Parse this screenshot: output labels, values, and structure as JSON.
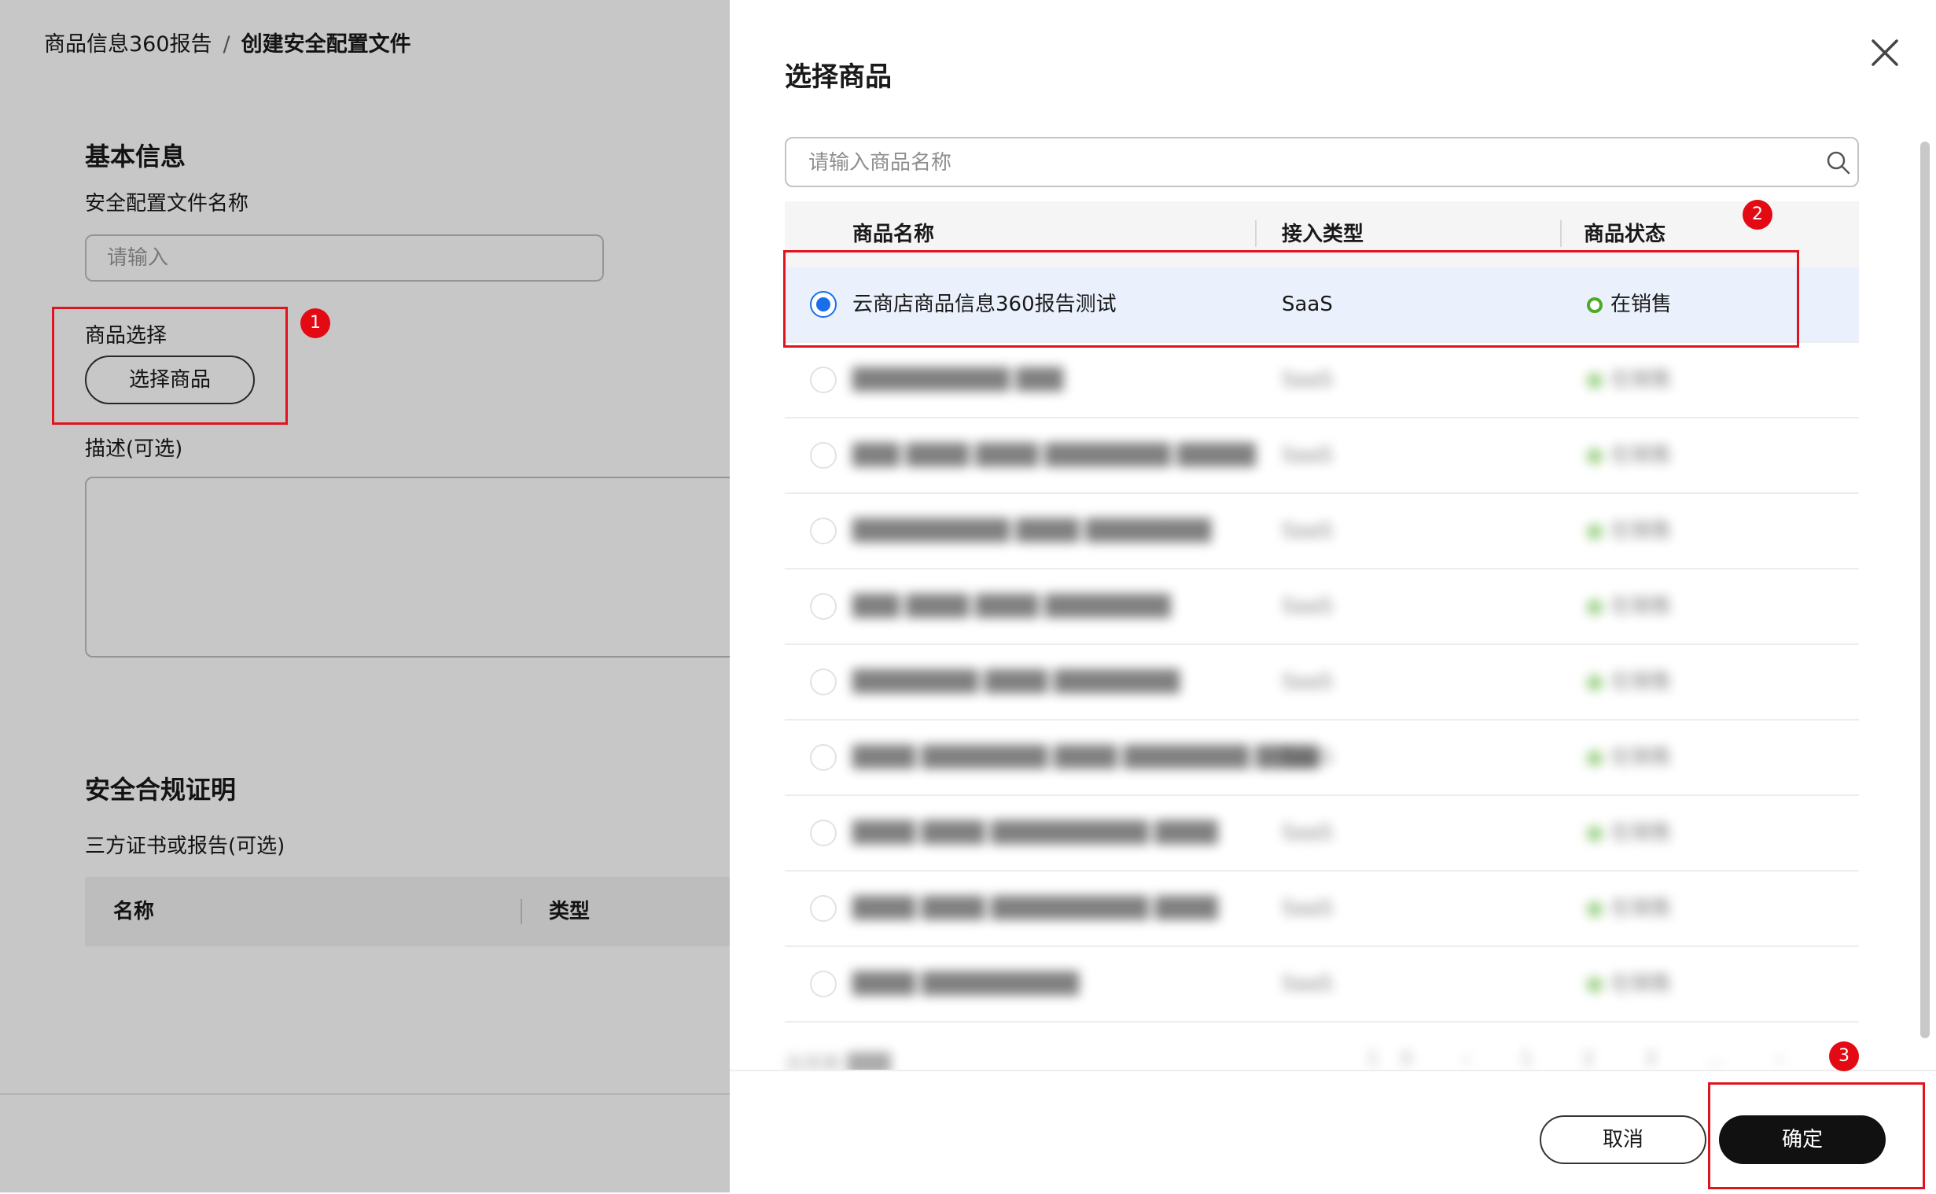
{
  "breadcrumb": {
    "parent": "商品信息360报告",
    "separator": "/",
    "current": "创建安全配置文件"
  },
  "basic_info": {
    "title": "基本信息",
    "name_label": "安全配置文件名称",
    "name_placeholder": "请输入",
    "product_label": "商品选择",
    "select_button": "选择商品",
    "desc_label": "描述(可选)"
  },
  "compliance": {
    "title": "安全合规证明",
    "cert_label": "三方证书或报告(可选)",
    "columns": [
      "名称",
      "类型"
    ]
  },
  "drawer": {
    "title": "选择商品",
    "search_placeholder": "请输入商品名称",
    "columns": [
      "商品名称",
      "接入类型",
      "商品状态"
    ],
    "rows": [
      {
        "name": "云商店商品信息360报告测试",
        "type": "SaaS",
        "status": "在销售",
        "selected": true
      },
      {
        "name": "██████████ ███",
        "type": "SaaS",
        "status": "在销售",
        "selected": false
      },
      {
        "name": "███ ████ ████ ████████ █████",
        "type": "SaaS",
        "status": "在销售",
        "selected": false
      },
      {
        "name": "██████████ ████ ████████",
        "type": "SaaS",
        "status": "在销售",
        "selected": false
      },
      {
        "name": "███ ████ ████ ████████",
        "type": "SaaS",
        "status": "在销售",
        "selected": false
      },
      {
        "name": "████████ ████ ████████",
        "type": "SaaS",
        "status": "在销售",
        "selected": false
      },
      {
        "name": "████ ████████ ████ ████████ ████",
        "type": "SaaS",
        "status": "在销售",
        "selected": false
      },
      {
        "name": "████ ████ ██████████ ████",
        "type": "SaaS",
        "status": "在销售",
        "selected": false
      },
      {
        "name": "████ ████ ██████████ ████",
        "type": "SaaS",
        "status": "在销售",
        "selected": false
      },
      {
        "name": "████ ██████████",
        "type": "SaaS",
        "status": "在销售",
        "selected": false
      }
    ],
    "pager_total": "总条数 ███",
    "pager_pages": "10 ‹ 1 2 3 … ›",
    "cancel_button": "取消",
    "ok_button": "确定"
  },
  "annotations": [
    "1",
    "2",
    "3"
  ],
  "colors": {
    "accent": "#1a6ee8",
    "status_green": "#4caa24",
    "annotation_red": "#e40a14",
    "primary_button": "#111111"
  }
}
